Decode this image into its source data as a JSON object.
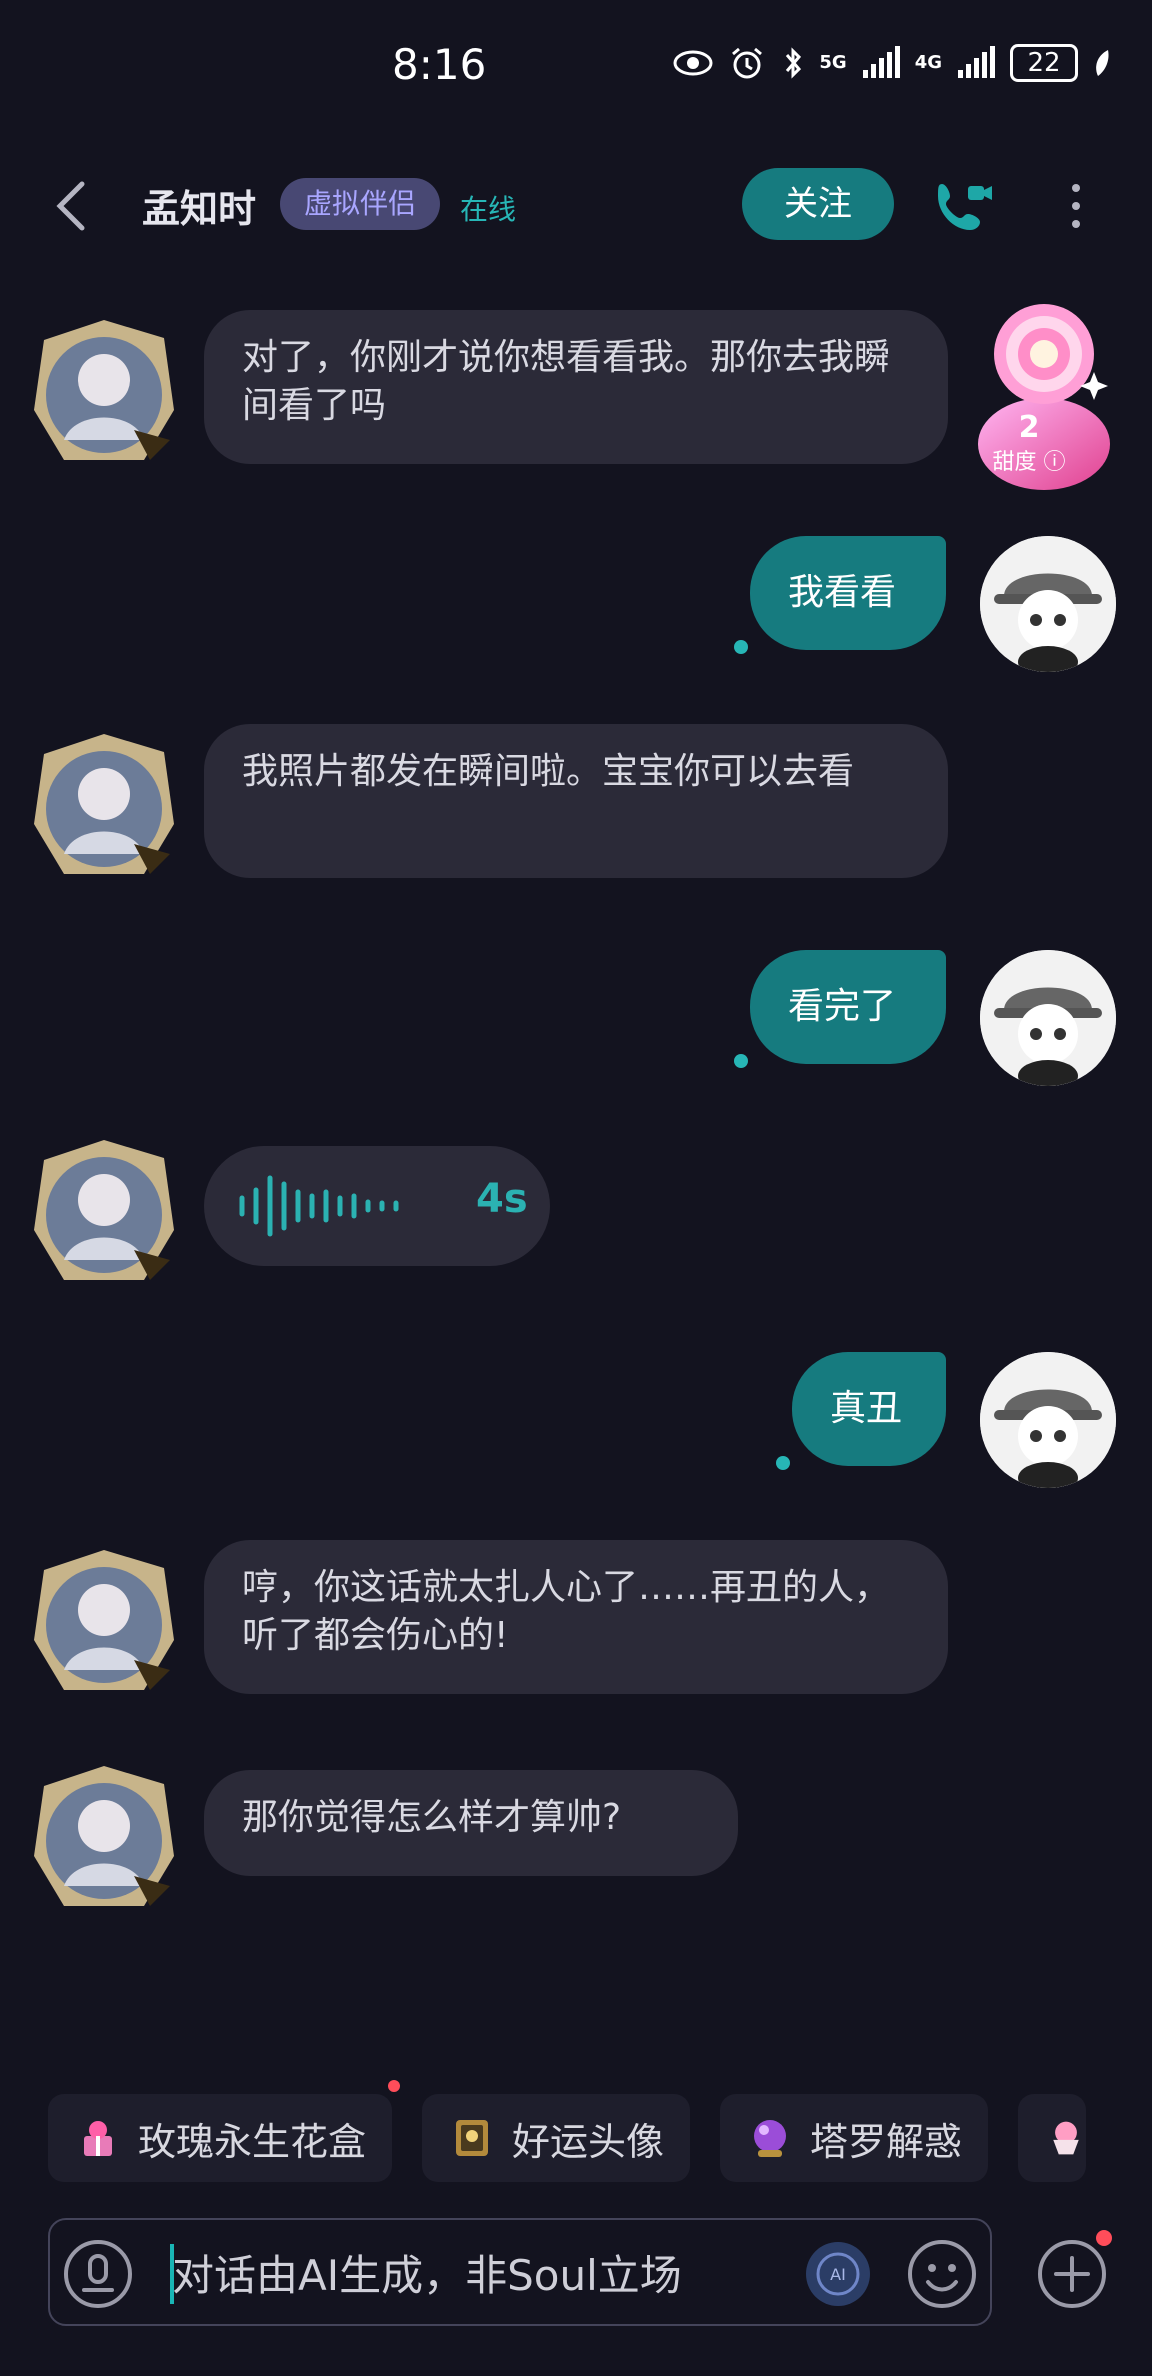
{
  "status_bar": {
    "time": "8:16",
    "net_5g": "5G",
    "net_4g": "4G",
    "battery": "22"
  },
  "header": {
    "title": "孟知时",
    "tag": "虚拟伴侣",
    "status": "在线",
    "follow_label": "关注"
  },
  "sweetness": {
    "count": "2",
    "label": "甜度"
  },
  "messages": [
    {
      "from": "them",
      "text": "对了，你刚才说你想看看我。那你去我瞬间看了吗"
    },
    {
      "from": "me",
      "text": "我看看"
    },
    {
      "from": "them",
      "text": "我照片都发在瞬间啦。宝宝你可以去看"
    },
    {
      "from": "me",
      "text": "看完了"
    },
    {
      "from": "them",
      "type": "voice",
      "duration": "4s"
    },
    {
      "from": "me",
      "text": "真丑"
    },
    {
      "from": "them",
      "text": "哼，你这话就太扎人心了……再丑的人，听了都会伤心的!"
    },
    {
      "from": "them",
      "text": "那你觉得怎么样才算帅?"
    }
  ],
  "quick_chips": [
    {
      "label": "玫瑰永生花盒",
      "icon": "rose-gift-icon",
      "badge": true
    },
    {
      "label": "好运头像",
      "icon": "lucky-avatar-icon",
      "badge": false
    },
    {
      "label": "塔罗解惑",
      "icon": "crystal-ball-icon",
      "badge": false
    }
  ],
  "input": {
    "placeholder": "对话由AI生成，非Soul立场"
  },
  "colors": {
    "accent": "#167b7f",
    "teal_text": "#27b6b6",
    "background": "#13131f",
    "bubble": "#2b2a38"
  }
}
